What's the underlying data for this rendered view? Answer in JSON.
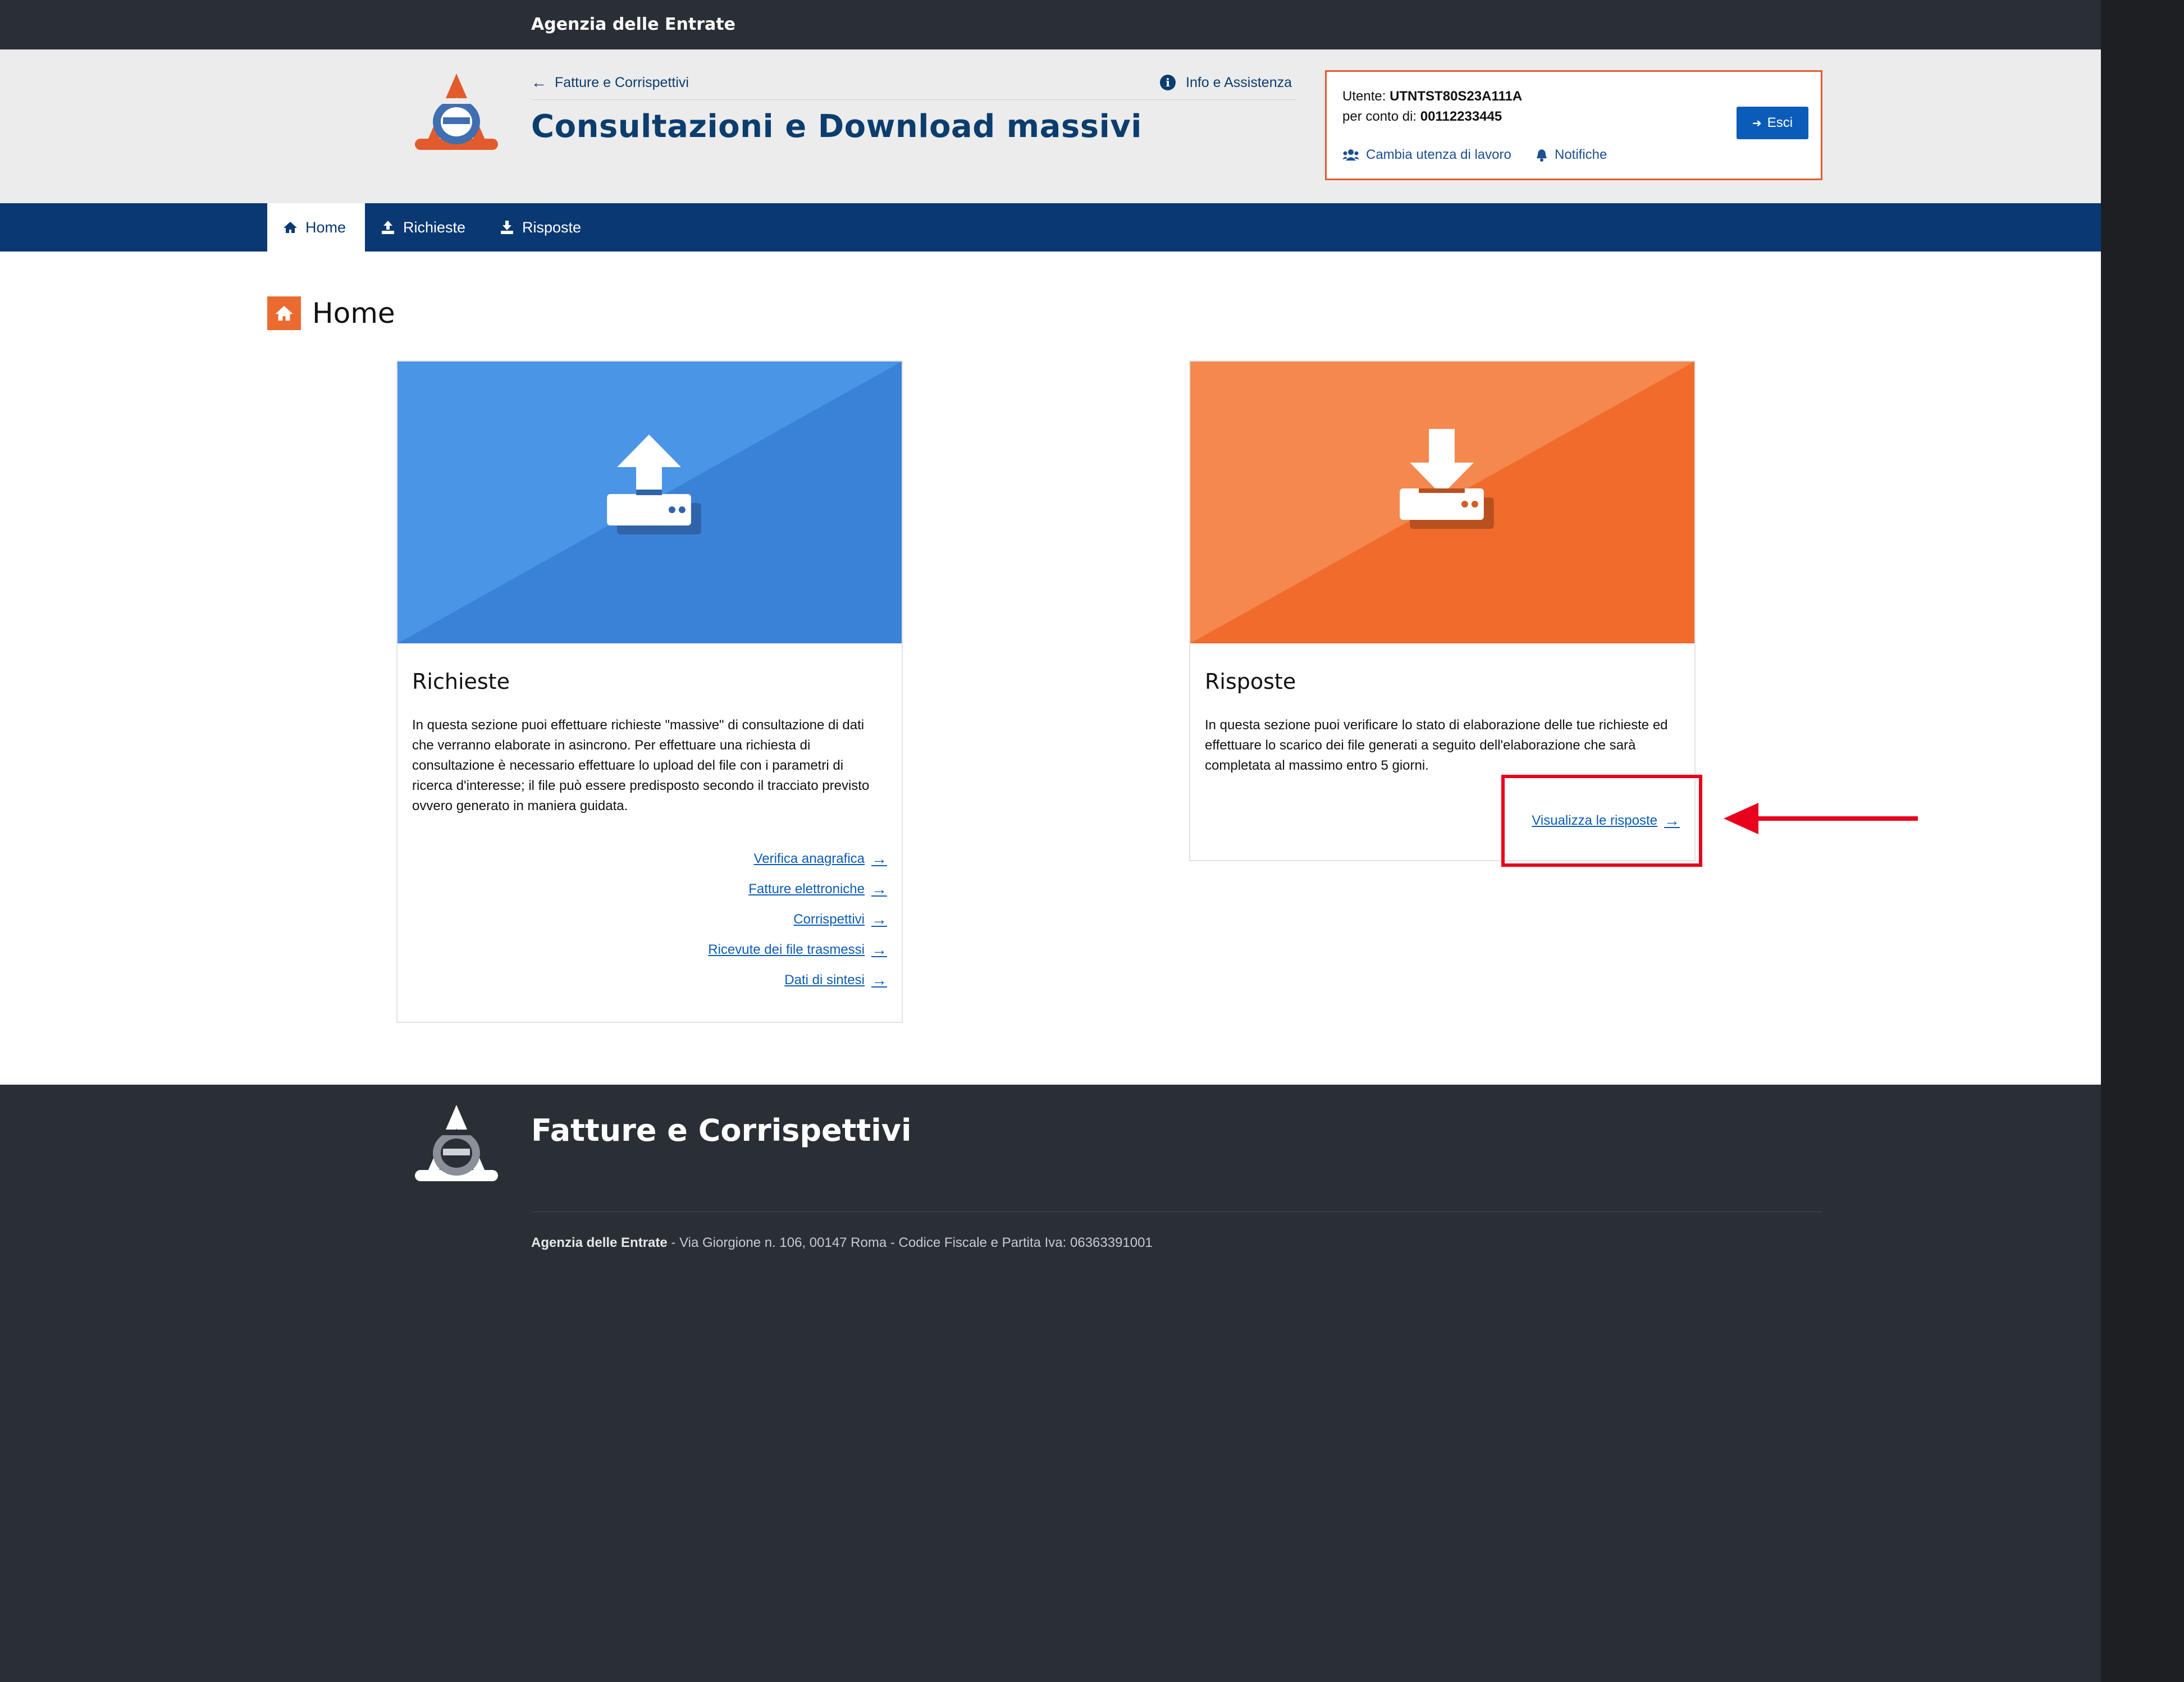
{
  "topbar": {
    "brand": "Agenzia delle Entrate"
  },
  "header": {
    "breadcrumb": "Fatture e Corrispettivi",
    "info": "Info e Assistenza",
    "title": "Consultazioni e Download massivi",
    "user": {
      "label_user": "Utente:",
      "user_code": "UTNTST80S23A111A",
      "label_account": "per conto di:",
      "account_code": "00112233445",
      "change_link": "Cambia utenza di lavoro",
      "notifications_link": "Notifiche",
      "logout_button": "Esci"
    }
  },
  "nav": {
    "items": [
      {
        "label": "Home",
        "icon": "home-icon",
        "active": true
      },
      {
        "label": "Richieste",
        "icon": "upload-icon"
      },
      {
        "label": "Risposte",
        "icon": "download-icon"
      }
    ]
  },
  "page": {
    "heading": "Home"
  },
  "cards": {
    "richieste": {
      "title": "Richieste",
      "text": "In questa sezione puoi effettuare richieste \"massive\" di consultazione di dati che verranno elaborate in asincrono. Per effettuare una richiesta di consultazione è necessario effettuare lo upload del file con i parametri di ricerca d'interesse; il file può essere predisposto secondo il tracciato previsto ovvero generato in maniera guidata.",
      "links": [
        "Verifica anagrafica",
        "Fatture elettroniche",
        "Corrispettivi",
        "Ricevute dei file trasmessi",
        "Dati di sintesi"
      ],
      "banner_color": "#3c8ee0"
    },
    "risposte": {
      "title": "Risposte",
      "text": "In questa sezione puoi verificare lo stato di elaborazione delle tue richieste ed effettuare lo scarico dei file generati a seguito dell'elaborazione che sarà completata al massimo entro 5 giorni.",
      "link": "Visualizza le risposte",
      "banner_color": "#f07a3e"
    }
  },
  "footer": {
    "title": "Fatture e Corrispettivi",
    "org": "Agenzia delle Entrate",
    "address": " - Via Giorgione n. 106, 00147 Roma - Codice Fiscale e Partita Iva: 06363391001"
  },
  "colors": {
    "brand_blue": "#0a3873",
    "accent_orange": "#ea6a2f",
    "annotation_red": "#e8001c"
  }
}
